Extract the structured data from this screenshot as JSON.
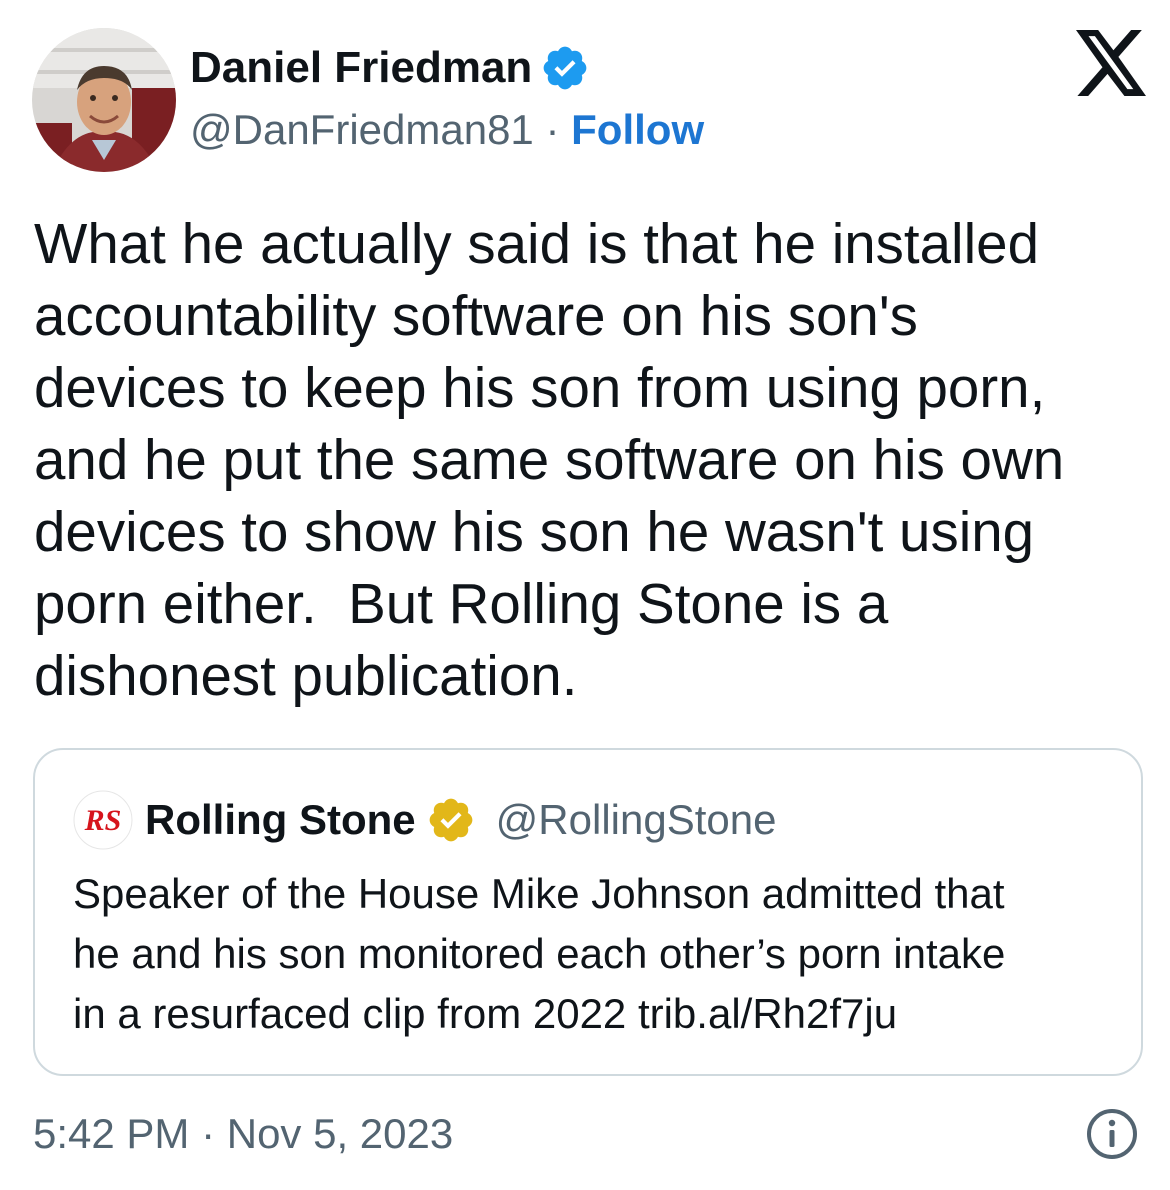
{
  "author": {
    "display_name": "Daniel Friedman",
    "handle": "@DanFriedman81",
    "separator": "·",
    "follow_label": "Follow",
    "verified_badge_icon": "blue-verified-check-icon"
  },
  "platform_icon": "x-logo-icon",
  "tweet": {
    "lines": [
      "What he actually said is that he installed",
      "accountability software on his son's",
      "devices to keep his son from using porn,",
      "and he put the same software on his own",
      "devices to show his son he wasn't using",
      "porn either.  But Rolling Stone is a",
      "dishonest publication."
    ]
  },
  "quoted_tweet": {
    "logo_text": "RS",
    "display_name": "Rolling Stone",
    "handle": "@RollingStone",
    "verified_badge_icon": "gold-verified-check-icon",
    "lines": [
      "Speaker of the House Mike Johnson admitted that",
      "he and his son monitored each other’s porn intake",
      "in a resurfaced clip from 2022 trib.al/Rh2f7ju"
    ]
  },
  "timestamp": "5:42 PM · Nov 5, 2023",
  "info_icon": "info-icon",
  "colors": {
    "text": "#0f1419",
    "secondary_text": "#536471",
    "link": "#1d76d2",
    "blue_badge": "#1d9bf0",
    "gold_badge": "#e2b719",
    "rs_red": "#d6141c",
    "border": "#cfd9de"
  }
}
